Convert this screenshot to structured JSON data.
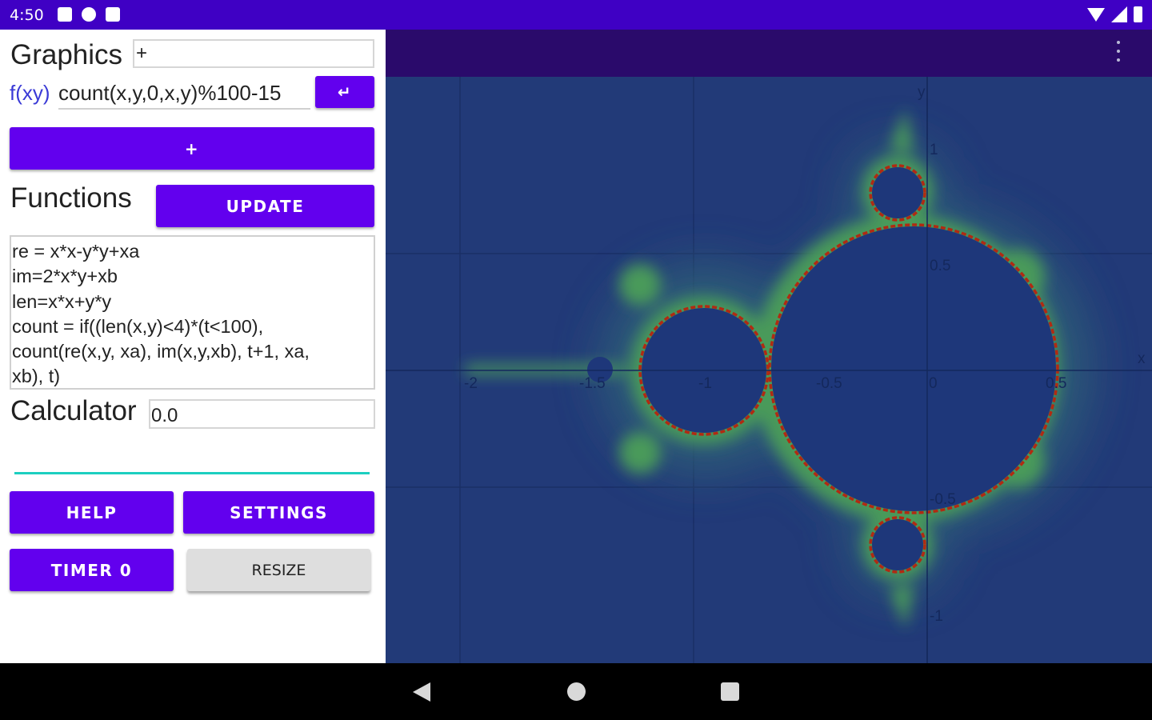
{
  "status_bar": {
    "time": "4:50",
    "left_icons": [
      "a-notification-icon",
      "play-notification-icon",
      "sd-card-icon"
    ],
    "right_icons": [
      "wifi-icon",
      "signal-icon",
      "battery-icon"
    ]
  },
  "left_panel": {
    "graphics_label": "Graphics",
    "graphics_input_value": "+",
    "fxy_label": "f(xy)",
    "fxy_input_value": "count(x,y,0,x,y)%100-15",
    "enter_button_label": "↵",
    "add_button_label": "+",
    "functions_label": "Functions",
    "update_button_label": "UPDATE",
    "functions_text": "re = x*x-y*y+xa\nim=2*x*y+xb\nlen=x*x+y*y\ncount = if((len(x,y)<4)*(t<100),\ncount(re(x,y, xa), im(x,y,xb), t+1, xa,\nxb), t)",
    "calculator_label": "Calculator",
    "calculator_value": "0.0",
    "help_button_label": "HELP",
    "settings_button_label": "SETTINGS",
    "timer_button_label": "TIMER 0",
    "resize_button_label": "RESIZE"
  },
  "graph": {
    "x_axis_name": "x",
    "y_axis_name": "y",
    "x_ticks": [
      "-2",
      "-1.5",
      "-1",
      "-0.5",
      "0",
      "0.5"
    ],
    "y_ticks": [
      "1",
      "0.5",
      "-0.5",
      "-1"
    ],
    "colors": {
      "background": "#223a78",
      "interior": "#1e377a",
      "halo": "#3f8a6e",
      "edge": "#6ab339",
      "boundary": "#b12a12"
    }
  },
  "app_bar": {
    "overflow_icon": "more-vert-icon"
  },
  "nav_bar": {
    "icons": [
      "back-icon",
      "home-icon",
      "recents-icon"
    ]
  }
}
